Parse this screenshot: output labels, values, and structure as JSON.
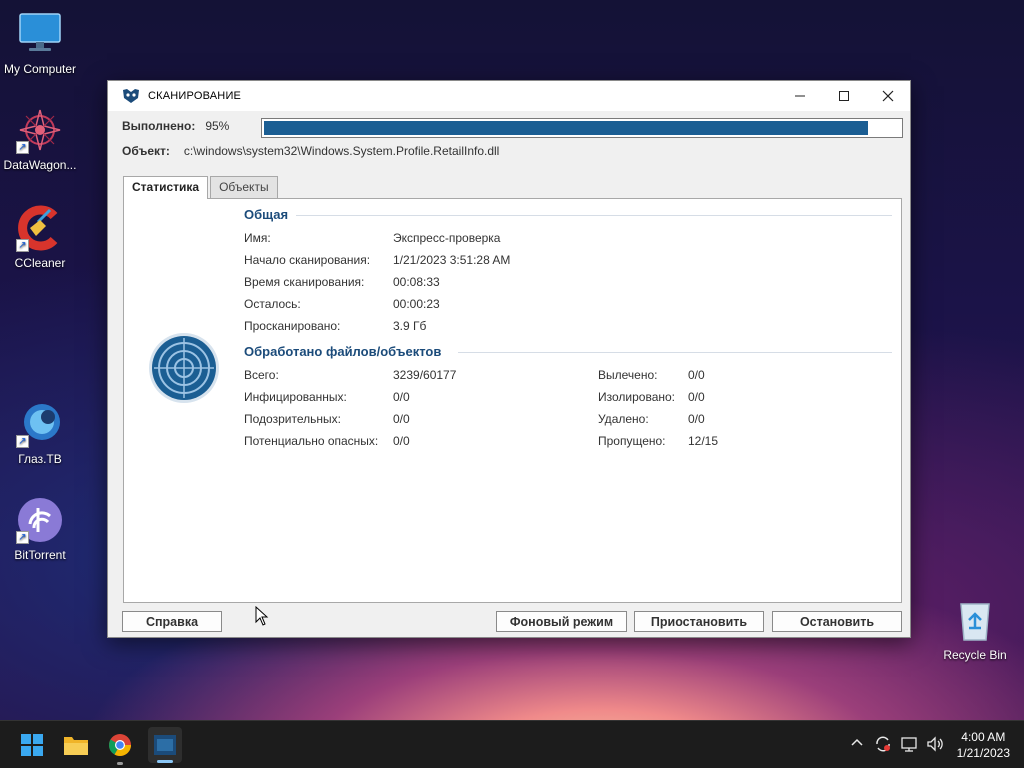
{
  "desktop": {
    "icons": [
      {
        "label": "My Computer",
        "icon": "monitor-icon"
      },
      {
        "label": "DataWagon...",
        "icon": "datawagon-icon"
      },
      {
        "label": "CCleaner",
        "icon": "ccleaner-icon"
      },
      {
        "label": "Глаз.ТВ",
        "icon": "glaz-tv-icon"
      },
      {
        "label": "BitTorrent",
        "icon": "bittorrent-icon"
      },
      {
        "label": "Recycle Bin",
        "icon": "recycle-bin-icon"
      }
    ]
  },
  "window": {
    "title": "СКАНИРОВАНИЕ",
    "progress_label": "Выполнено:",
    "progress_percent_text": "95%",
    "progress_value": 0.95,
    "object_label": "Объект:",
    "object_path": "c:\\windows\\system32\\Windows.System.Profile.RetailInfo.dll",
    "tabs": [
      {
        "label": "Статистика",
        "active": true
      },
      {
        "label": "Объекты",
        "active": false
      }
    ],
    "general": {
      "title": "Общая",
      "rows": [
        {
          "key": "Имя:",
          "value": "Экспресс-проверка"
        },
        {
          "key": "Начало сканирования:",
          "value": "1/21/2023 3:51:28 AM"
        },
        {
          "key": "Время сканирования:",
          "value": "00:08:33"
        },
        {
          "key": "Осталось:",
          "value": "00:00:23"
        },
        {
          "key": "Просканировано:",
          "value": "3.9 Гб"
        }
      ]
    },
    "processed": {
      "title": "Обработано файлов/объектов",
      "left": [
        {
          "key": "Всего:",
          "value": "3239/60177"
        },
        {
          "key": "Инфицированных:",
          "value": "0/0"
        },
        {
          "key": "Подозрительных:",
          "value": "0/0"
        },
        {
          "key": "Потенциально опасных:",
          "value": "0/0"
        }
      ],
      "right": [
        {
          "key": "Вылечено:",
          "value": "0/0"
        },
        {
          "key": "Изолировано:",
          "value": "0/0"
        },
        {
          "key": "Удалено:",
          "value": "0/0"
        },
        {
          "key": "Пропущено:",
          "value": "12/15"
        }
      ]
    },
    "buttons": {
      "help": "Справка",
      "background": "Фоновый режим",
      "pause": "Приостановить",
      "stop": "Остановить"
    }
  },
  "taskbar": {
    "time": "4:00 AM",
    "date": "1/21/2023",
    "apps": [
      "windows-start-icon",
      "file-explorer-icon",
      "chrome-icon",
      "scanner-app-icon"
    ],
    "tray": [
      "chevron-up-icon",
      "sync-icon",
      "network-icon",
      "volume-icon"
    ]
  },
  "colors": {
    "accent": "#1b5e93",
    "section_title": "#1b4b7a"
  }
}
